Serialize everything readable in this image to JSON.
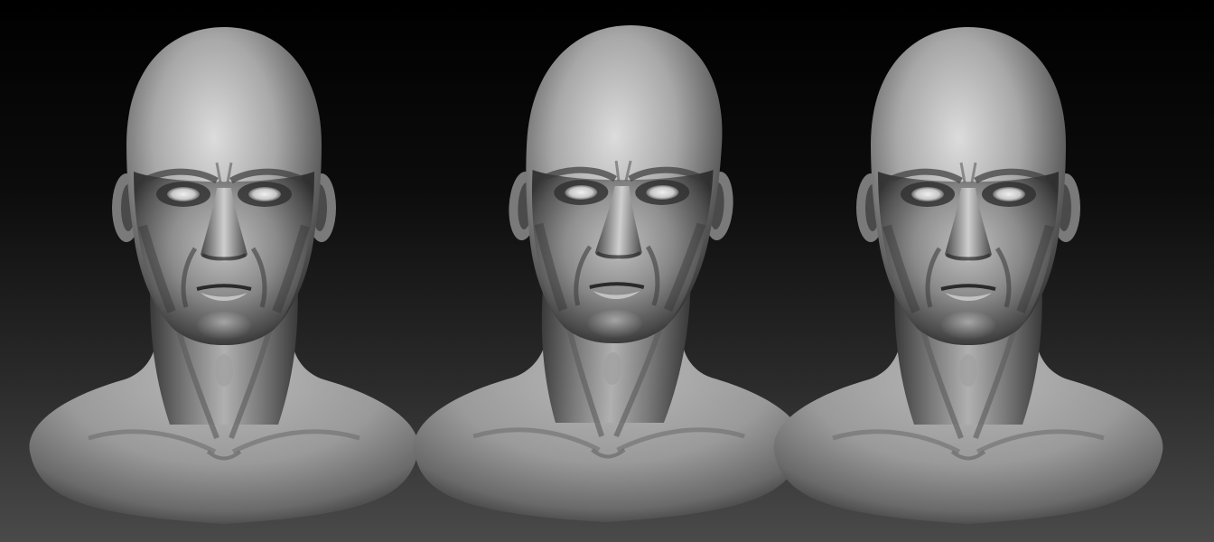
{
  "scene": {
    "background_top": "#000000",
    "background_bottom": "#4a4a4a",
    "material_light": "#d2d2d2",
    "material_mid": "#9a9a9a",
    "material_dark": "#2a2a2a",
    "busts": [
      {
        "view": "front"
      },
      {
        "view": "three-quarter"
      },
      {
        "view": "front"
      }
    ]
  }
}
